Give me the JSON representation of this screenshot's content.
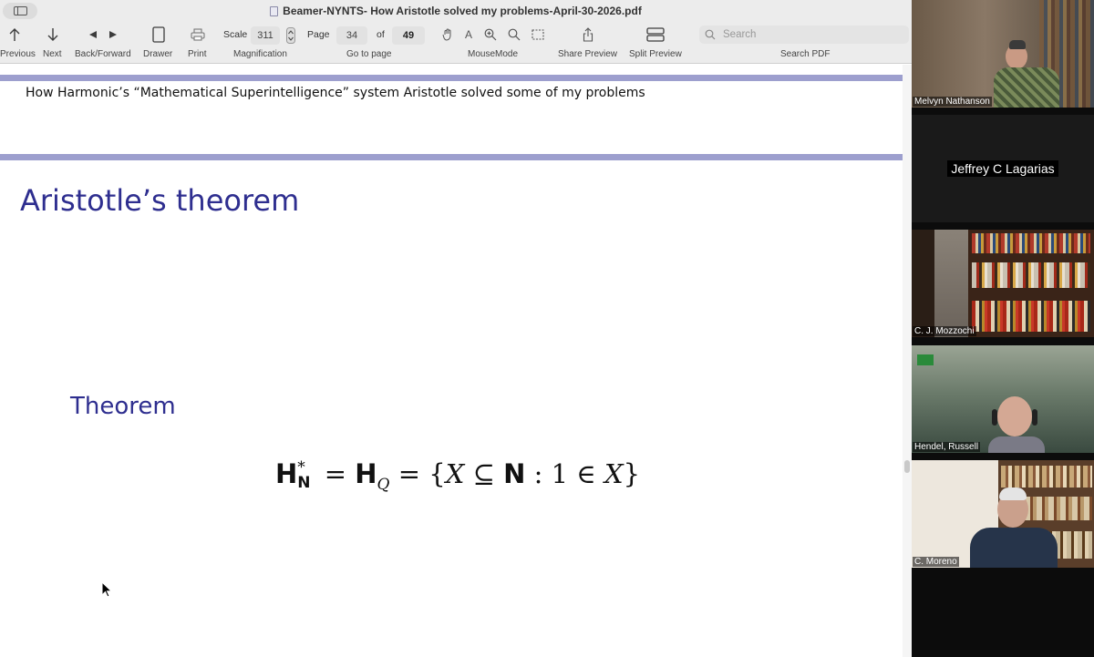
{
  "window": {
    "title": "Beamer-NYNTS- How Aristotle solved my problems-April-30-2026.pdf"
  },
  "toolbar": {
    "previous_label": "Previous",
    "next_label": "Next",
    "back_forward_label": "Back/Forward",
    "drawer_label": "Drawer",
    "print_label": "Print",
    "scale_label": "Scale",
    "scale_value": "311",
    "magnification_label": "Magnification",
    "page_label": "Page",
    "page_value": "34",
    "of_label": "of",
    "total_pages": "49",
    "go_to_page_label": "Go to page",
    "mousemode_label": "MouseMode",
    "share_preview_label": "Share Preview",
    "split_preview_label": "Split Preview",
    "search_placeholder": "Search",
    "search_pdf_label": "Search PDF",
    "text_tool_glyph": "A"
  },
  "slide": {
    "header": "How Harmonic’s “Mathematical Superintelligence” system Aristotle  solved some of my problems",
    "frame_title": "Aristotle’s theorem",
    "theorem_label": "Theorem",
    "formula": {
      "h": "H",
      "star": "*",
      "n_sub": "N",
      "eq1": "=",
      "q_sub": "Q",
      "eq2": "=",
      "set_open": "{",
      "x1": "X",
      "subseteq": "⊆",
      "n_bold": "N",
      "colon": ":",
      "one": "1",
      "in": "∈",
      "x2": "X",
      "set_close": "}"
    },
    "accent_color": "#2e2e8f",
    "rule_color": "#9d9fce"
  },
  "participants": [
    {
      "name": "Melvyn Nathanson"
    },
    {
      "name": "Jeffrey C Lagarias"
    },
    {
      "name": "C. J. Mozzochi"
    },
    {
      "name": "Hendel, Russell"
    },
    {
      "name": "C. Moreno"
    }
  ]
}
